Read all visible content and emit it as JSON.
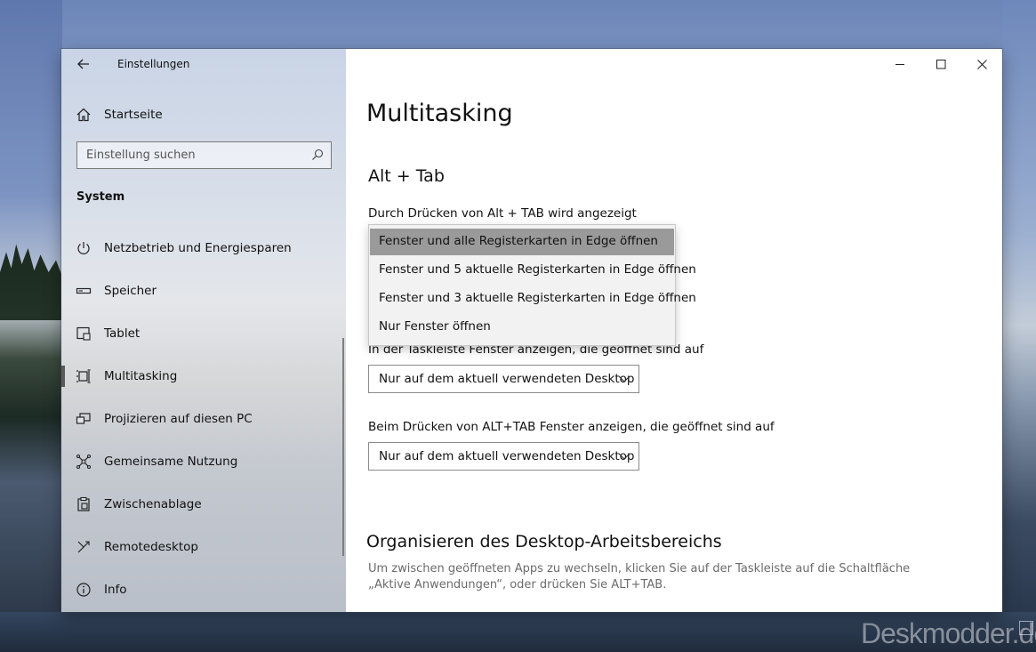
{
  "window": {
    "app_title": "Einstellungen",
    "controls": {
      "minimize": "minimize-icon",
      "maximize": "maximize-icon",
      "close": "close-icon"
    }
  },
  "sidebar": {
    "home_label": "Startseite",
    "search_placeholder": "Einstellung suchen",
    "section_title": "System",
    "items": [
      {
        "label": "Netzbetrieb und Energiesparen",
        "icon": "power-icon"
      },
      {
        "label": "Speicher",
        "icon": "storage-icon"
      },
      {
        "label": "Tablet",
        "icon": "tablet-icon"
      },
      {
        "label": "Multitasking",
        "icon": "multitasking-icon",
        "active": true
      },
      {
        "label": "Projizieren auf diesen PC",
        "icon": "project-icon"
      },
      {
        "label": "Gemeinsame Nutzung",
        "icon": "share-icon"
      },
      {
        "label": "Zwischenablage",
        "icon": "clipboard-icon"
      },
      {
        "label": "Remotedesktop",
        "icon": "remote-desktop-icon"
      },
      {
        "label": "Info",
        "icon": "info-icon"
      }
    ]
  },
  "main": {
    "page_title": "Multitasking",
    "alt_tab": {
      "heading": "Alt + Tab",
      "label": "Durch Drücken von Alt + TAB wird angezeigt",
      "options": [
        "Fenster und alle Registerkarten in Edge öffnen",
        "Fenster und 5 aktuelle Registerkarten in Edge öffnen",
        "Fenster und 3 aktuelle Registerkarten in Edge öffnen",
        "Nur Fenster öffnen"
      ],
      "selected_index": 0
    },
    "taskbar": {
      "label": "In der Taskleiste Fenster anzeigen, die geöffnet sind auf",
      "value": "Nur auf dem aktuell verwendeten Desktop"
    },
    "alttab_windows": {
      "label": "Beim Drücken von ALT+TAB Fenster anzeigen, die geöffnet sind auf",
      "value": "Nur auf dem aktuell verwendeten Desktop"
    },
    "workspace": {
      "heading": "Organisieren des Desktop-Arbeitsbereichs",
      "description": "Um zwischen geöffneten Apps zu wechseln, klicken Sie auf der Taskleiste auf die Schaltfläche „Aktive Anwendungen“, oder drücken Sie ALT+TAB."
    }
  },
  "watermark": "Deskmodder.de"
}
